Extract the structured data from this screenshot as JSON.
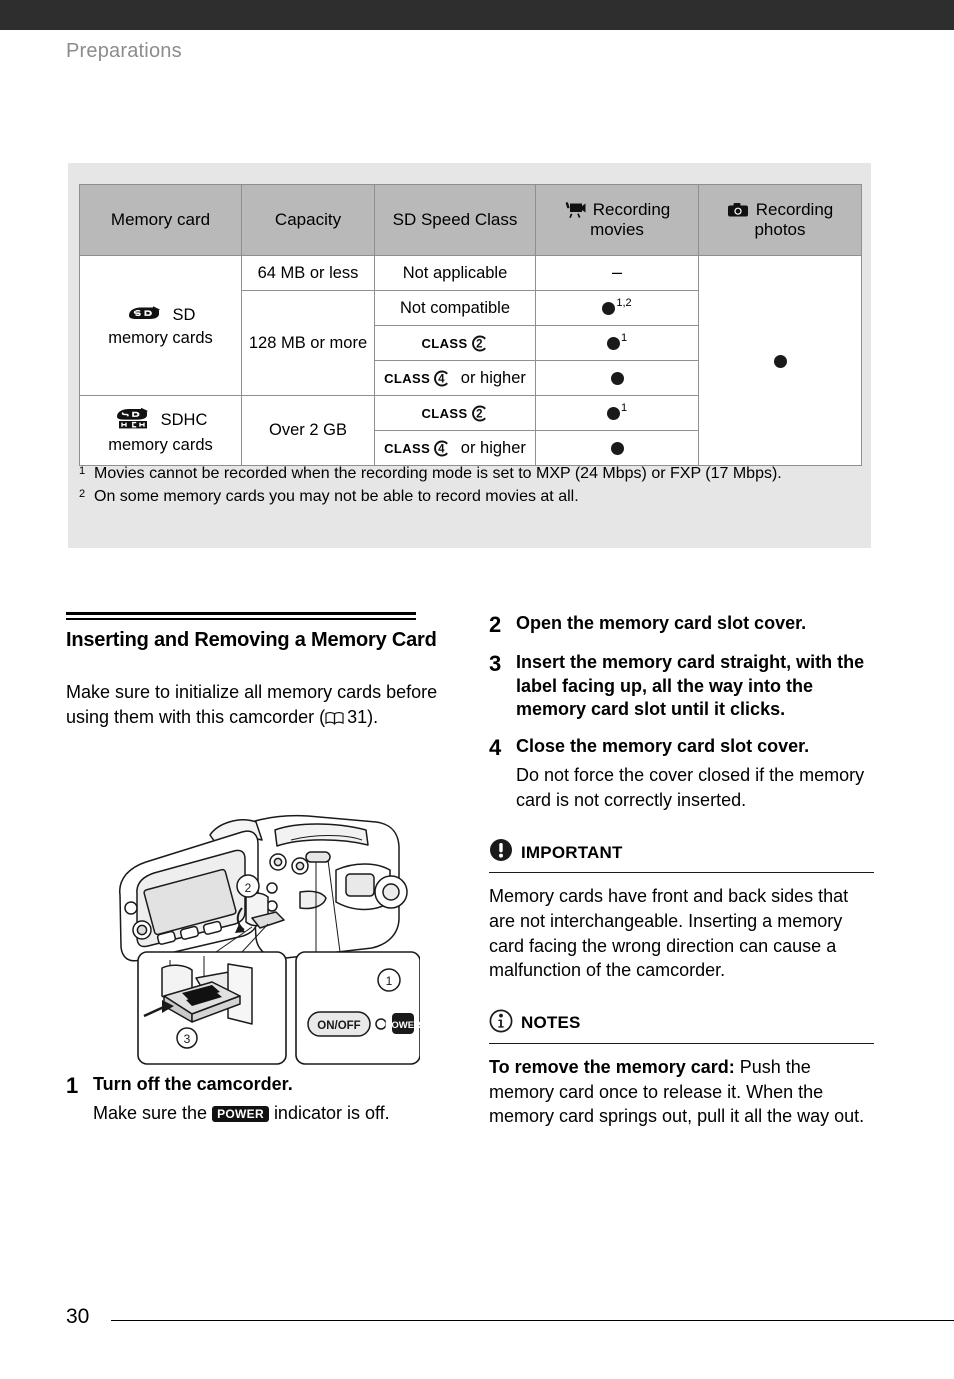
{
  "header": {
    "running_head": "Preparations",
    "bar_color": "#2e2e2e",
    "running_head_color": "#8c8c8c"
  },
  "table_panel": {
    "background": "#e6e6e6",
    "header_background": "#b9b9b9",
    "columns": [
      {
        "key": "memory_card",
        "label": "Memory card",
        "icon": null
      },
      {
        "key": "capacity",
        "label": "Capacity",
        "icon": null
      },
      {
        "key": "sd_speed_class",
        "label": "SD Speed Class",
        "icon": null
      },
      {
        "key": "recording_movies",
        "label_line1": "Recording",
        "label_line2": "movies",
        "icon": "movie-camera-icon"
      },
      {
        "key": "recording_photos",
        "label_line1": "Recording",
        "label_line2": "photos",
        "icon": "photo-camera-icon"
      }
    ],
    "groups": [
      {
        "card_type": "SD",
        "card_type_sub": "memory cards",
        "card_logo": "sd-logo",
        "rows": [
          {
            "capacity": "64 MB or less",
            "speed_class": "Not applicable",
            "speed_class_type": "text",
            "movies": "dash",
            "movies_superscript": ""
          },
          {
            "capacity": "128 MB or more",
            "speed_class": "Not compatible",
            "speed_class_type": "text",
            "movies": "dot",
            "movies_superscript": "1,2"
          },
          {
            "capacity": "",
            "speed_class": "CLASS 2",
            "speed_class_type": "class",
            "class_number": "2",
            "class_suffix": "",
            "movies": "dot",
            "movies_superscript": "1"
          },
          {
            "capacity": "",
            "speed_class": "CLASS 4 or higher",
            "speed_class_type": "class",
            "class_number": "4",
            "class_suffix": "or higher",
            "movies": "dot",
            "movies_superscript": ""
          }
        ]
      },
      {
        "card_type": "SDHC",
        "card_type_sub": "memory cards",
        "card_logo": "sdhc-logo",
        "rows": [
          {
            "capacity": "Over 2 GB",
            "speed_class": "CLASS 2",
            "speed_class_type": "class",
            "class_number": "2",
            "class_suffix": "",
            "movies": "dot",
            "movies_superscript": "1"
          },
          {
            "capacity": "",
            "speed_class": "CLASS 4 or higher",
            "speed_class_type": "class",
            "class_number": "4",
            "class_suffix": "or higher",
            "movies": "dot",
            "movies_superscript": ""
          }
        ]
      }
    ],
    "photos_cell": "dot",
    "footnotes": [
      {
        "marker": "1",
        "text": "Movies cannot be recorded when the recording mode is set to MXP (24 Mbps) or FXP (17 Mbps)."
      },
      {
        "marker": "2",
        "text": "On some memory cards you may not be able to record movies at all."
      }
    ]
  },
  "left_column": {
    "section_title": "Inserting and Removing a Memory Card",
    "intro_text_before": "Make sure to initialize all memory cards before using them with this camcorder (",
    "intro_page_ref": "31",
    "intro_text_after": ").",
    "illustration": {
      "callout_1": "1",
      "callout_2": "2",
      "callout_3": "3",
      "onoff_label": "ON/OFF",
      "power_label": "POWER"
    },
    "step1": {
      "number": "1",
      "title": "Turn off the camcorder.",
      "sub_before": "Make sure the",
      "badge": "POWER",
      "sub_after": "indicator is off."
    }
  },
  "right_column": {
    "steps": [
      {
        "number": "2",
        "title": "Open the memory card slot cover.",
        "sub": ""
      },
      {
        "number": "3",
        "title": "Insert the memory card straight, with the label facing up, all the way into the memory card slot until it clicks.",
        "sub": ""
      },
      {
        "number": "4",
        "title": "Close the memory card slot cover.",
        "sub": "Do not force the cover closed if the memory card is not correctly inserted."
      }
    ],
    "important": {
      "icon": "exclamation-circle-icon",
      "title": "IMPORTANT",
      "body": "Memory cards have front and back sides that are not interchangeable. Inserting a memory card facing the wrong direction can cause a malfunction of the camcorder."
    },
    "notes": {
      "icon": "info-circle-icon",
      "title": "NOTES",
      "body_lead": "To remove the memory card:",
      "body": " Push the memory card once to release it. When the memory card springs out, pull it all the way out."
    }
  },
  "footer": {
    "page_number": "30"
  }
}
